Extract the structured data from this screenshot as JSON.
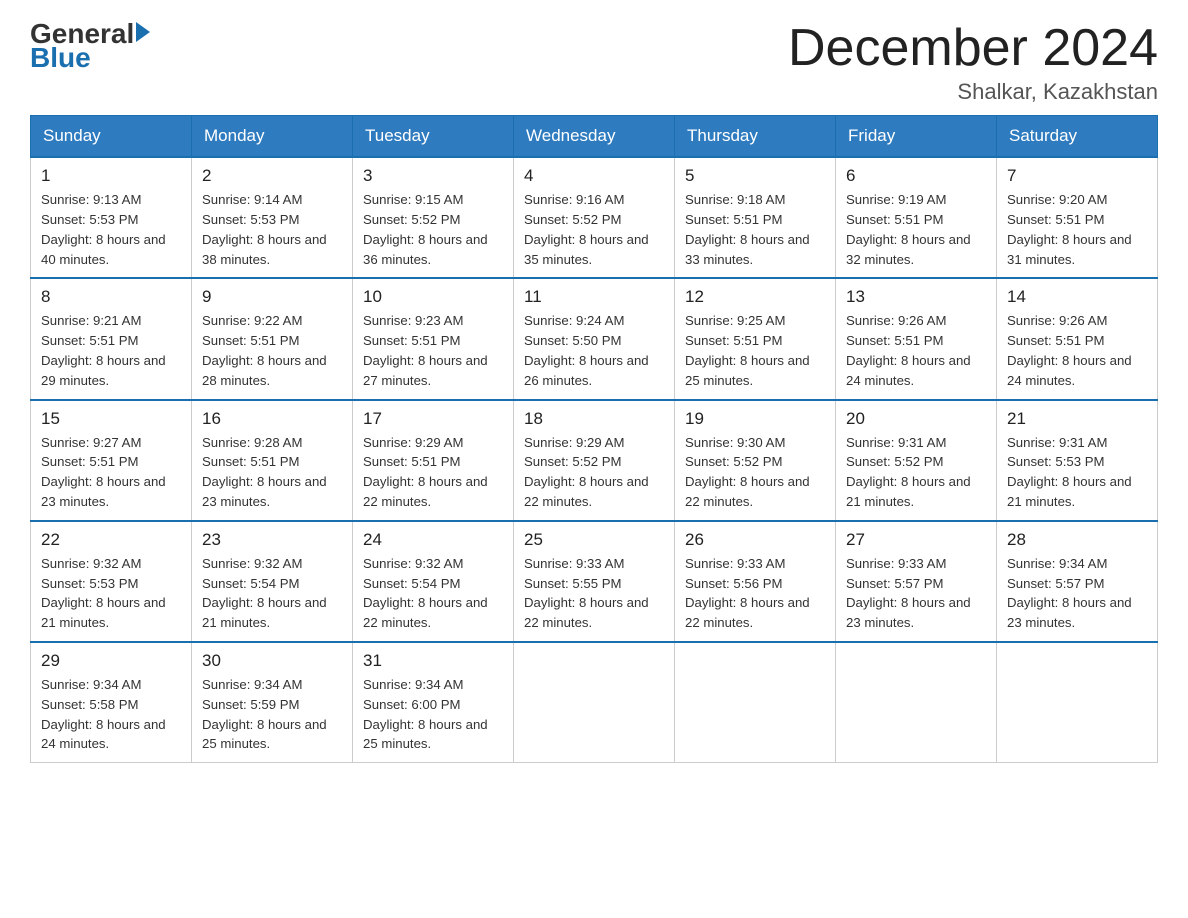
{
  "logo": {
    "general": "General",
    "blue": "Blue",
    "arrow": "▶"
  },
  "title": {
    "month_year": "December 2024",
    "location": "Shalkar, Kazakhstan"
  },
  "days_of_week": [
    "Sunday",
    "Monday",
    "Tuesday",
    "Wednesday",
    "Thursday",
    "Friday",
    "Saturday"
  ],
  "weeks": [
    [
      {
        "day": "1",
        "sunrise": "9:13 AM",
        "sunset": "5:53 PM",
        "daylight": "8 hours and 40 minutes."
      },
      {
        "day": "2",
        "sunrise": "9:14 AM",
        "sunset": "5:53 PM",
        "daylight": "8 hours and 38 minutes."
      },
      {
        "day": "3",
        "sunrise": "9:15 AM",
        "sunset": "5:52 PM",
        "daylight": "8 hours and 36 minutes."
      },
      {
        "day": "4",
        "sunrise": "9:16 AM",
        "sunset": "5:52 PM",
        "daylight": "8 hours and 35 minutes."
      },
      {
        "day": "5",
        "sunrise": "9:18 AM",
        "sunset": "5:51 PM",
        "daylight": "8 hours and 33 minutes."
      },
      {
        "day": "6",
        "sunrise": "9:19 AM",
        "sunset": "5:51 PM",
        "daylight": "8 hours and 32 minutes."
      },
      {
        "day": "7",
        "sunrise": "9:20 AM",
        "sunset": "5:51 PM",
        "daylight": "8 hours and 31 minutes."
      }
    ],
    [
      {
        "day": "8",
        "sunrise": "9:21 AM",
        "sunset": "5:51 PM",
        "daylight": "8 hours and 29 minutes."
      },
      {
        "day": "9",
        "sunrise": "9:22 AM",
        "sunset": "5:51 PM",
        "daylight": "8 hours and 28 minutes."
      },
      {
        "day": "10",
        "sunrise": "9:23 AM",
        "sunset": "5:51 PM",
        "daylight": "8 hours and 27 minutes."
      },
      {
        "day": "11",
        "sunrise": "9:24 AM",
        "sunset": "5:50 PM",
        "daylight": "8 hours and 26 minutes."
      },
      {
        "day": "12",
        "sunrise": "9:25 AM",
        "sunset": "5:51 PM",
        "daylight": "8 hours and 25 minutes."
      },
      {
        "day": "13",
        "sunrise": "9:26 AM",
        "sunset": "5:51 PM",
        "daylight": "8 hours and 24 minutes."
      },
      {
        "day": "14",
        "sunrise": "9:26 AM",
        "sunset": "5:51 PM",
        "daylight": "8 hours and 24 minutes."
      }
    ],
    [
      {
        "day": "15",
        "sunrise": "9:27 AM",
        "sunset": "5:51 PM",
        "daylight": "8 hours and 23 minutes."
      },
      {
        "day": "16",
        "sunrise": "9:28 AM",
        "sunset": "5:51 PM",
        "daylight": "8 hours and 23 minutes."
      },
      {
        "day": "17",
        "sunrise": "9:29 AM",
        "sunset": "5:51 PM",
        "daylight": "8 hours and 22 minutes."
      },
      {
        "day": "18",
        "sunrise": "9:29 AM",
        "sunset": "5:52 PM",
        "daylight": "8 hours and 22 minutes."
      },
      {
        "day": "19",
        "sunrise": "9:30 AM",
        "sunset": "5:52 PM",
        "daylight": "8 hours and 22 minutes."
      },
      {
        "day": "20",
        "sunrise": "9:31 AM",
        "sunset": "5:52 PM",
        "daylight": "8 hours and 21 minutes."
      },
      {
        "day": "21",
        "sunrise": "9:31 AM",
        "sunset": "5:53 PM",
        "daylight": "8 hours and 21 minutes."
      }
    ],
    [
      {
        "day": "22",
        "sunrise": "9:32 AM",
        "sunset": "5:53 PM",
        "daylight": "8 hours and 21 minutes."
      },
      {
        "day": "23",
        "sunrise": "9:32 AM",
        "sunset": "5:54 PM",
        "daylight": "8 hours and 21 minutes."
      },
      {
        "day": "24",
        "sunrise": "9:32 AM",
        "sunset": "5:54 PM",
        "daylight": "8 hours and 22 minutes."
      },
      {
        "day": "25",
        "sunrise": "9:33 AM",
        "sunset": "5:55 PM",
        "daylight": "8 hours and 22 minutes."
      },
      {
        "day": "26",
        "sunrise": "9:33 AM",
        "sunset": "5:56 PM",
        "daylight": "8 hours and 22 minutes."
      },
      {
        "day": "27",
        "sunrise": "9:33 AM",
        "sunset": "5:57 PM",
        "daylight": "8 hours and 23 minutes."
      },
      {
        "day": "28",
        "sunrise": "9:34 AM",
        "sunset": "5:57 PM",
        "daylight": "8 hours and 23 minutes."
      }
    ],
    [
      {
        "day": "29",
        "sunrise": "9:34 AM",
        "sunset": "5:58 PM",
        "daylight": "8 hours and 24 minutes."
      },
      {
        "day": "30",
        "sunrise": "9:34 AM",
        "sunset": "5:59 PM",
        "daylight": "8 hours and 25 minutes."
      },
      {
        "day": "31",
        "sunrise": "9:34 AM",
        "sunset": "6:00 PM",
        "daylight": "8 hours and 25 minutes."
      },
      null,
      null,
      null,
      null
    ]
  ]
}
